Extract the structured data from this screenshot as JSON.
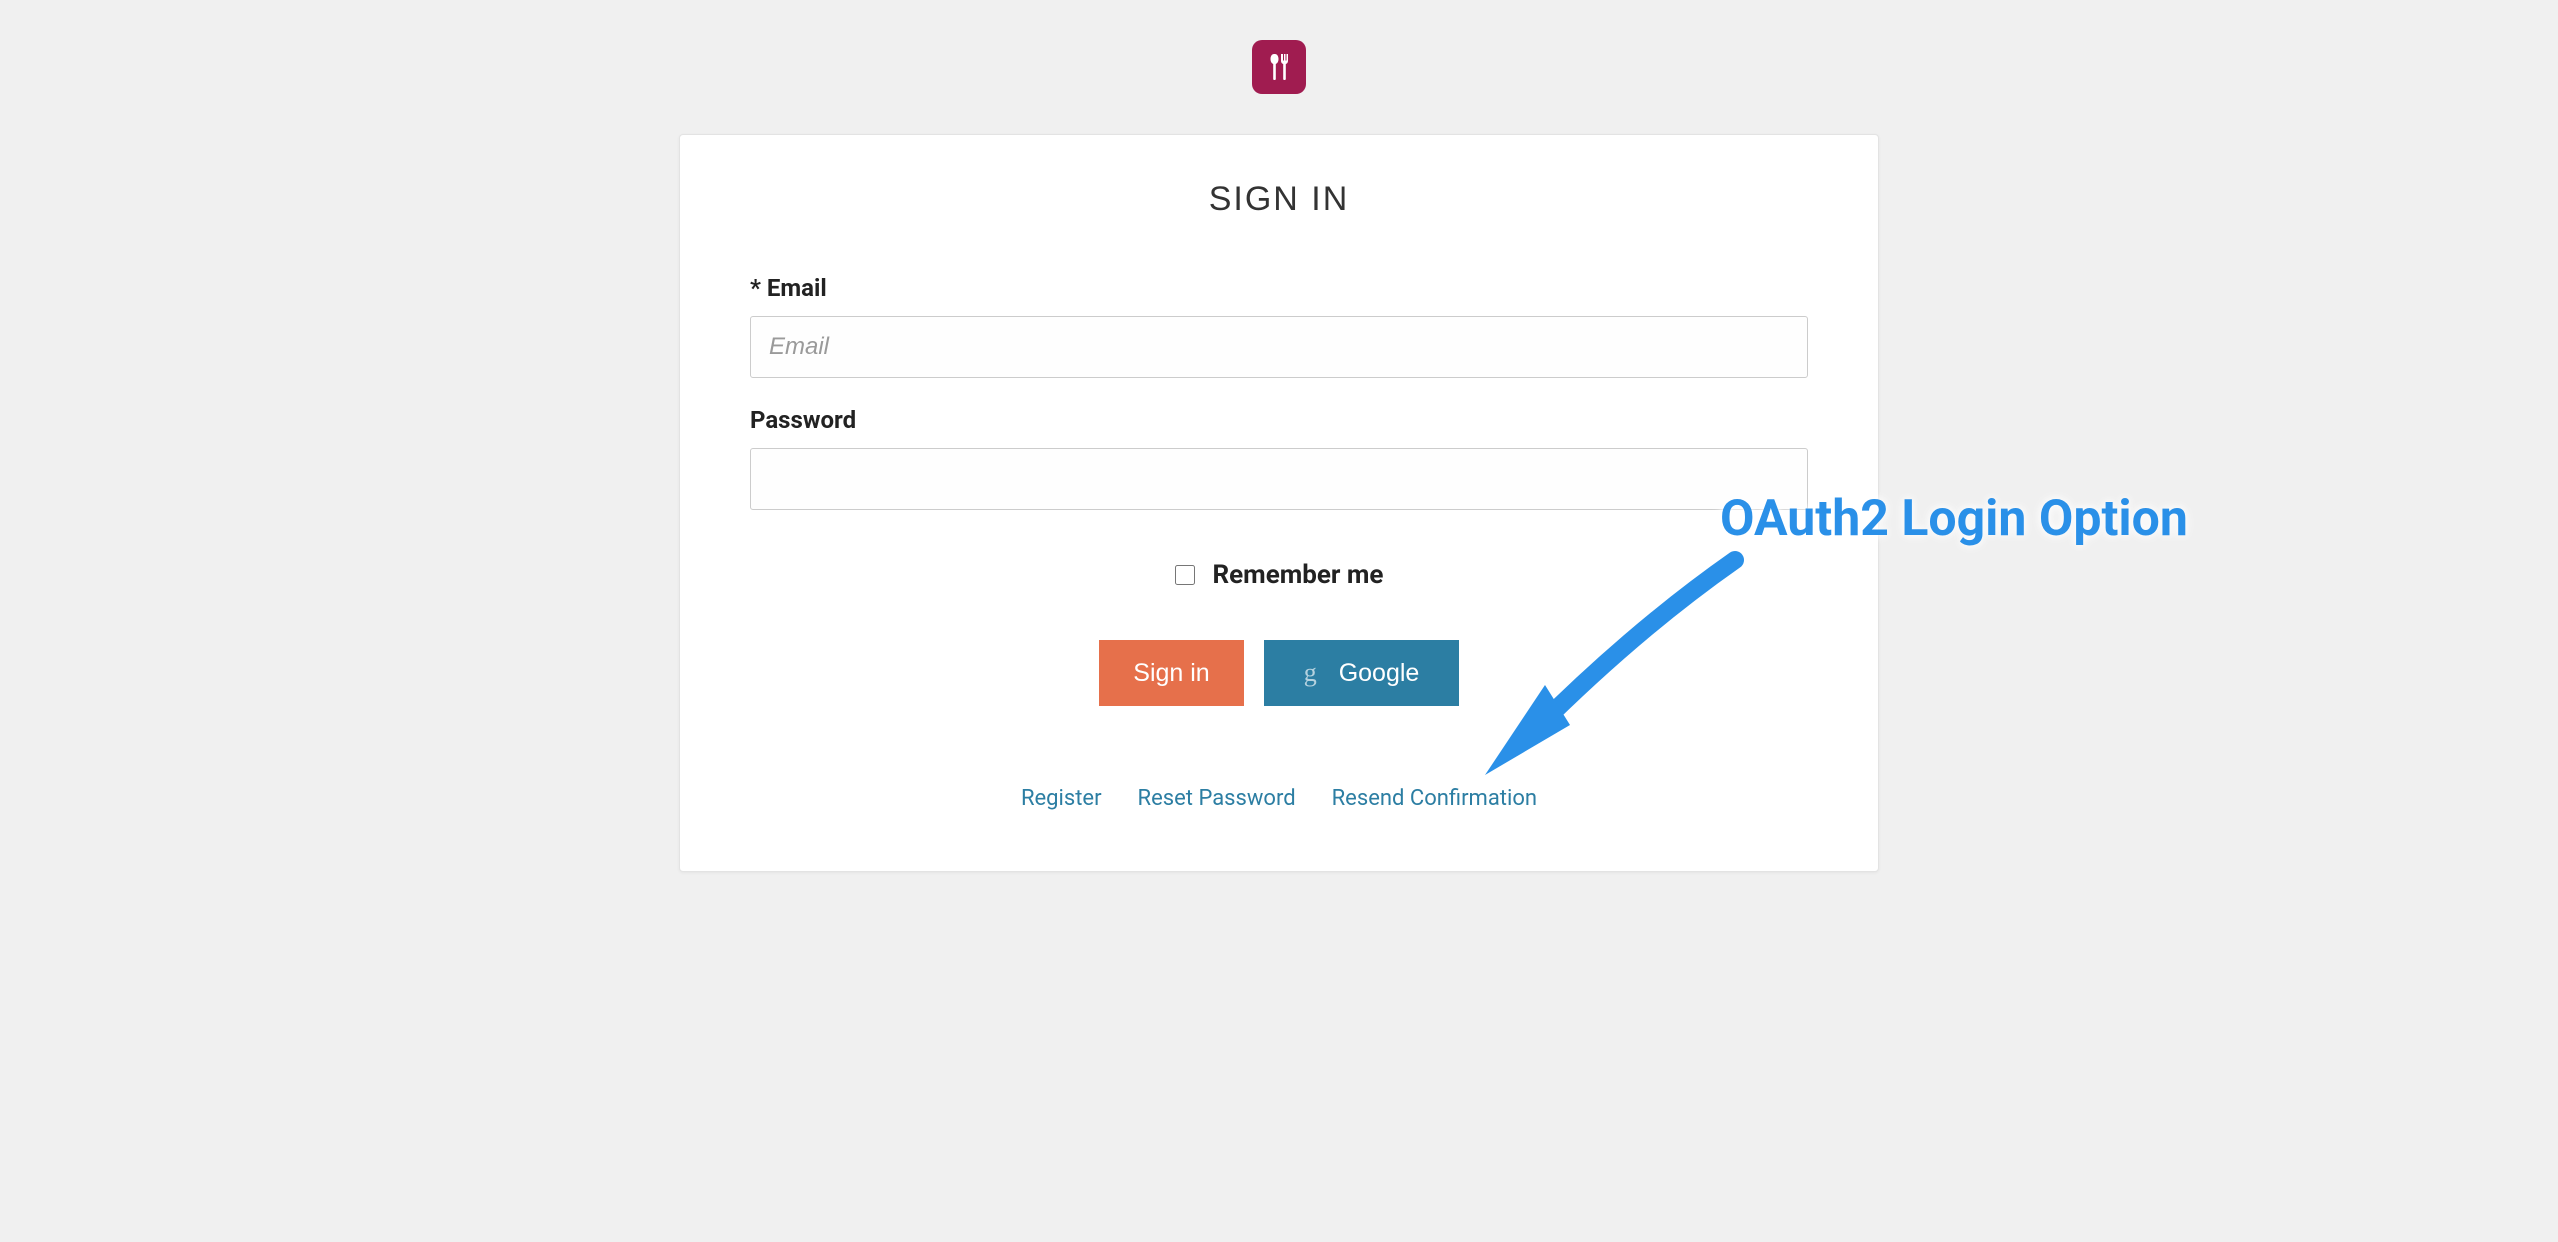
{
  "logo": {
    "name": "fork-spoon-icon",
    "bg_color": "#a01c50"
  },
  "card": {
    "title": "SIGN IN",
    "email_label": "* Email",
    "email_placeholder": "Email",
    "email_value": "",
    "password_label": "Password",
    "password_value": "",
    "remember_label": "Remember me",
    "remember_checked": false,
    "signin_button": "Sign in",
    "google_button": "Google",
    "links": {
      "register": "Register",
      "reset": "Reset Password",
      "resend": "Resend Confirmation"
    }
  },
  "annotation": {
    "text": "OAuth2 Login Option",
    "color": "#2a90e8"
  }
}
